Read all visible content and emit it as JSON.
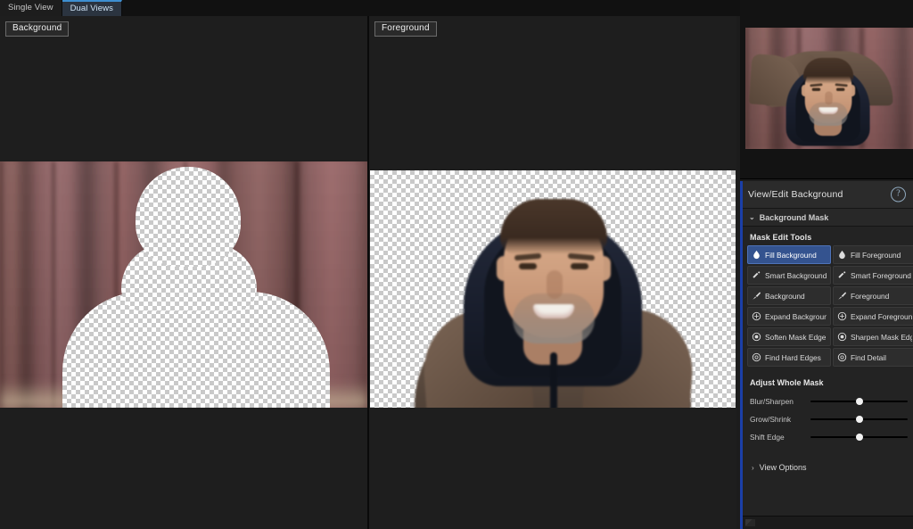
{
  "view_tabs": [
    {
      "label": "Single View",
      "active": false
    },
    {
      "label": "Dual Views",
      "active": true
    }
  ],
  "canvas": {
    "left_pane_label": "Background",
    "right_pane_label": "Foreground"
  },
  "preview": {
    "name": "source-image-preview"
  },
  "panel": {
    "title": "View/Edit Background",
    "help_icon": "help-icon",
    "section": {
      "label": "Background Mask",
      "expanded_chevron": "⌄"
    },
    "mask_edit_tools": {
      "title": "Mask Edit Tools",
      "buttons": [
        {
          "label": "Fill Background",
          "icon": "droplet-icon",
          "glyph": "●",
          "active": true
        },
        {
          "label": "Fill Foreground",
          "icon": "droplet-icon",
          "glyph": "●",
          "active": false
        },
        {
          "label": "Smart Background",
          "icon": "magic-wand-icon",
          "glyph": "✐",
          "active": false
        },
        {
          "label": "Smart Foreground",
          "icon": "magic-wand-icon",
          "glyph": "✐",
          "active": false
        },
        {
          "label": "Background",
          "icon": "brush-icon",
          "glyph": "✒",
          "active": false
        },
        {
          "label": "Foreground",
          "icon": "brush-icon",
          "glyph": "✒",
          "active": false
        },
        {
          "label": "Expand Background",
          "icon": "expand-icon",
          "glyph": "⨁",
          "active": false
        },
        {
          "label": "Expand Foreground",
          "icon": "expand-icon",
          "glyph": "⨁",
          "active": false
        },
        {
          "label": "Soften Mask Edge",
          "icon": "soften-icon",
          "glyph": "◉",
          "active": false
        },
        {
          "label": "Sharpen Mask Edge",
          "icon": "sharpen-icon",
          "glyph": "◉",
          "active": false
        },
        {
          "label": "Find Hard Edges",
          "icon": "find-edges-icon",
          "glyph": "○",
          "active": false
        },
        {
          "label": "Find Detail",
          "icon": "find-detail-icon",
          "glyph": "○",
          "active": false
        }
      ]
    },
    "adjust_whole_mask": {
      "title": "Adjust Whole Mask",
      "sliders": [
        {
          "label": "Blur/Sharpen",
          "value_percent": 50
        },
        {
          "label": "Grow/Shrink",
          "value_percent": 50
        },
        {
          "label": "Shift Edge",
          "value_percent": 50
        }
      ]
    },
    "view_options": {
      "label": "View Options",
      "collapsed_chevron": "›"
    }
  },
  "colors": {
    "accent_blue": "#1b3fa8",
    "active_tool_blue": "#34538f",
    "tab_active_blue": "#3d8fd1",
    "panel_bg": "#232323",
    "app_bg": "#1c1c1c"
  }
}
